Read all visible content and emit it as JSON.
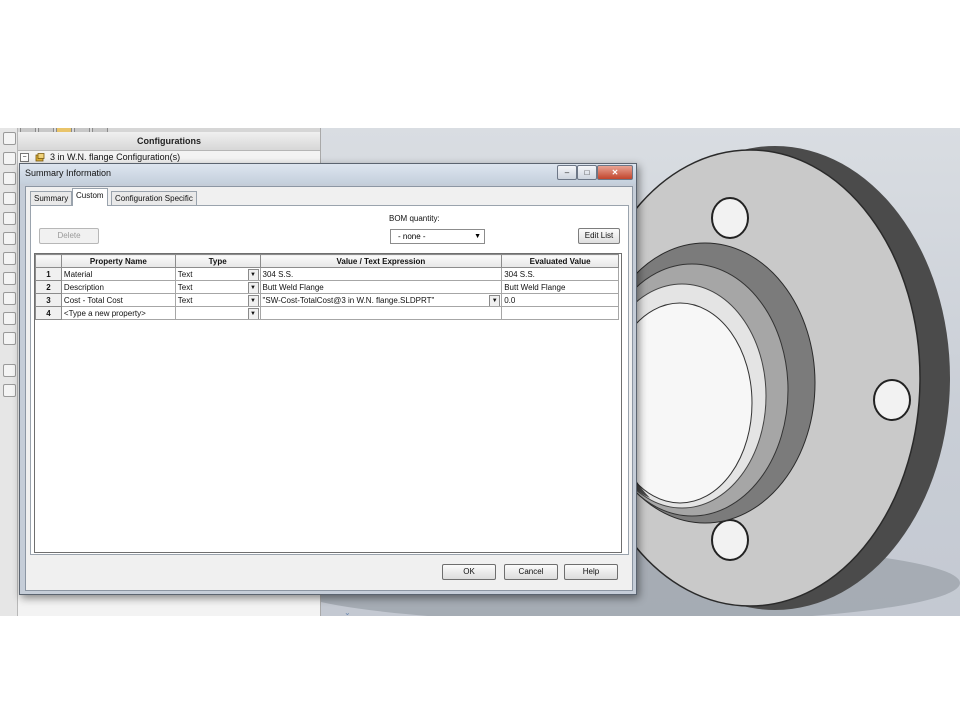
{
  "feature_manager": {
    "header": "Configurations",
    "config_item": "3 in W.N. flange Configuration(s)",
    "expander": "−"
  },
  "dialog": {
    "title": "Summary Information",
    "window_buttons": {
      "minimize": "–",
      "maximize": "□",
      "close": "✕"
    },
    "tabs": [
      {
        "label": "Summary"
      },
      {
        "label": "Custom",
        "active": true
      },
      {
        "label": "Configuration Specific"
      }
    ],
    "delete_label": "Delete",
    "bom_label": "BOM quantity:",
    "bom_value": "- none -",
    "edit_list_label": "Edit List",
    "columns": [
      "Property Name",
      "Type",
      "Value / Text Expression",
      "Evaluated Value"
    ],
    "rows": [
      {
        "num": "1",
        "name": "Material",
        "type": "Text",
        "value": "304 S.S.",
        "evaluated": "304 S.S."
      },
      {
        "num": "2",
        "name": "Description",
        "type": "Text",
        "value": "Butt Weld Flange",
        "evaluated": "Butt Weld Flange"
      },
      {
        "num": "3",
        "name": "Cost - Total Cost",
        "type": "Text",
        "value": "\"SW-Cost-TotalCost@3 in W.N. flange.SLDPRT\"",
        "evaluated": "0.0"
      },
      {
        "num": "4",
        "name": "<Type a new property>",
        "type": "",
        "value": "",
        "evaluated": ""
      }
    ],
    "ok_label": "OK",
    "cancel_label": "Cancel",
    "help_label": "Help"
  },
  "status": {
    "arrow": "⌄"
  },
  "colors": {
    "title_bar": "#c4cfdc",
    "close_button": "#c1452d",
    "viewport_bg": "#c9ced6",
    "flange_face": "#c8c8c8"
  }
}
